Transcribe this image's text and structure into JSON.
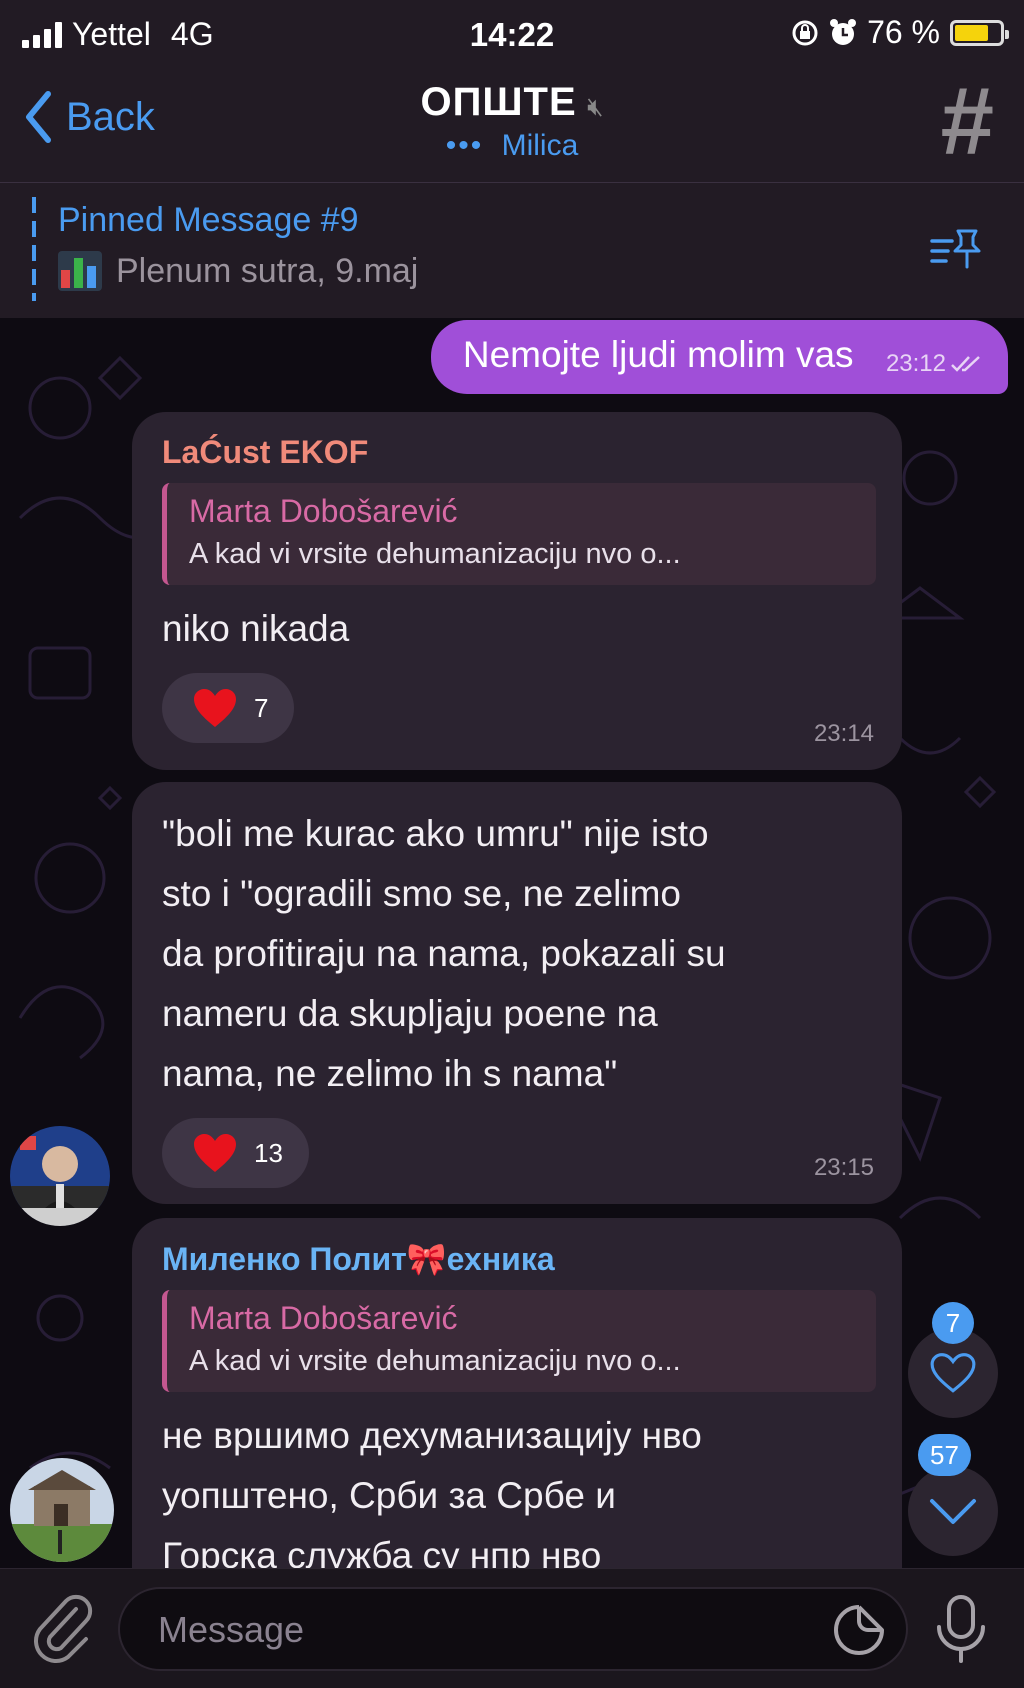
{
  "status": {
    "carrier": "Yettel",
    "network": "4G",
    "time": "14:22",
    "battery": "76 %",
    "battery_level": 0.76
  },
  "header": {
    "back_label": "Back",
    "title": "ОПШТЕ",
    "typing": "Milica"
  },
  "pinned": {
    "title": "Pinned Message #9",
    "text": "Plenum sutra, 9.maj"
  },
  "messages": {
    "outgoing": {
      "text": "Nemojte ljudi molim vas",
      "time": "23:12"
    },
    "m1": {
      "author": "LaĆust EKOF",
      "reply_name": "Marta Dobošarević",
      "reply_text": "A kad vi vrsite dehumanizaciju nvo o...",
      "text": "niko nikada",
      "reaction_count": "7",
      "time": "23:14"
    },
    "m2": {
      "lines": [
        "\"boli me kurac ako umru\" nije isto",
        "sto  i \"ogradili smo se, ne zelimo",
        "da profitiraju na nama, pokazali su",
        "nameru da skupljaju poene na",
        "nama, ne zelimo ih s nama\""
      ],
      "reaction_count": "13",
      "time": "23:15"
    },
    "m3": {
      "author": "Миленко Полит🎀ехника",
      "reply_name": "Marta Dobošarević",
      "reply_text": "A kad vi vrsite dehumanizaciju nvo o...",
      "lines": [
        "не вршимо дехуманизацију нво",
        "уопштено, Срби за Србе и",
        "Горска служба су нпр нво"
      ]
    }
  },
  "fabs": {
    "reactions_badge": "7",
    "unread_badge": "57"
  },
  "input": {
    "placeholder": "Message"
  },
  "colors": {
    "accent": "#4a9bf0",
    "outgoing_bubble": "#a04fd8",
    "incoming_bubble": "#2b2330",
    "author1": "#f08a7a",
    "author3": "#6ab4f5",
    "reply": "#d86aa5"
  }
}
